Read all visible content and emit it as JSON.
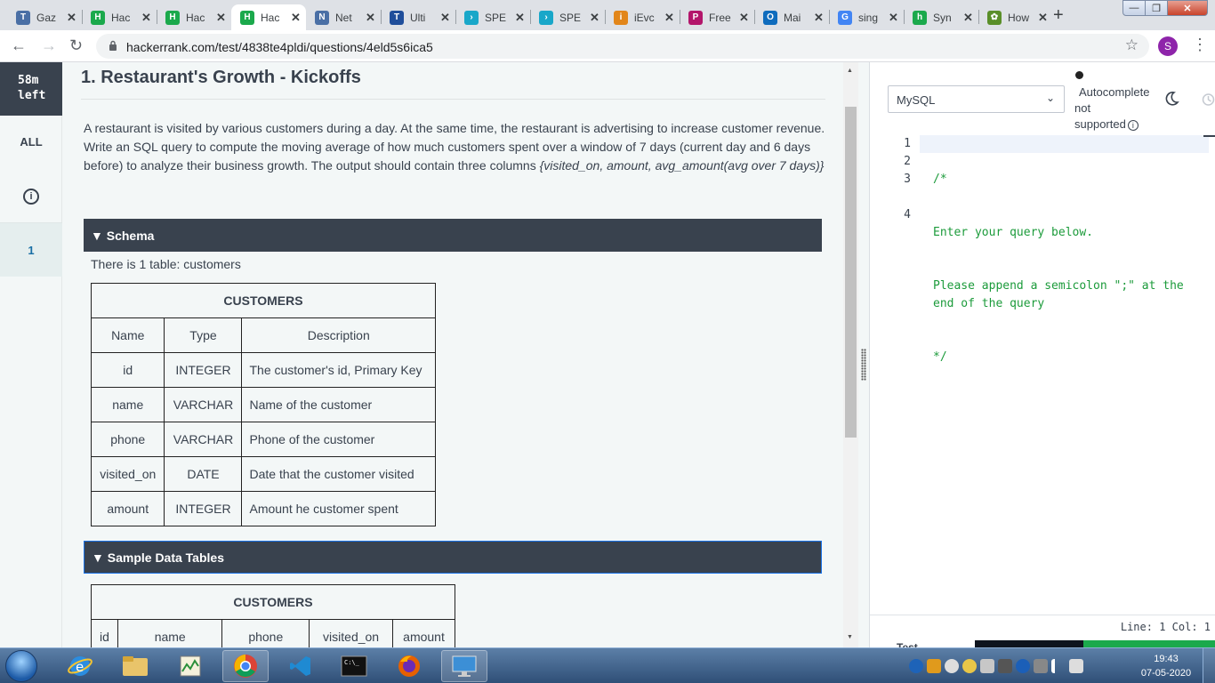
{
  "browser": {
    "tabs": [
      {
        "title": "Gaz",
        "color": "#4a6fa5",
        "glyph": "T"
      },
      {
        "title": "Hac",
        "color": "#1ba94c",
        "glyph": "H"
      },
      {
        "title": "Hac",
        "color": "#1ba94c",
        "glyph": "H"
      },
      {
        "title": "Hac",
        "color": "#1ba94c",
        "glyph": "H",
        "active": true
      },
      {
        "title": "Net",
        "color": "#4a6fa5",
        "glyph": "N"
      },
      {
        "title": "Ulti",
        "color": "#1f4e9b",
        "glyph": "T"
      },
      {
        "title": "SPE",
        "color": "#19a7c9",
        "glyph": "›"
      },
      {
        "title": "SPE",
        "color": "#19a7c9",
        "glyph": "›"
      },
      {
        "title": "iEvc",
        "color": "#e2861a",
        "glyph": "i"
      },
      {
        "title": "Free",
        "color": "#b3166b",
        "glyph": "P"
      },
      {
        "title": "Mai",
        "color": "#0f6cbd",
        "glyph": "O"
      },
      {
        "title": "sing",
        "color": "#4285f4",
        "glyph": "G"
      },
      {
        "title": "Syn",
        "color": "#1ba94c",
        "glyph": "h"
      },
      {
        "title": "How",
        "color": "#5a8f29",
        "glyph": "✿"
      }
    ],
    "new_tab": "+",
    "url": "hackerrank.com/test/4838te4pldi/questions/4eld5s6ica5",
    "profile_initial": "S"
  },
  "sidebar": {
    "timer_value": "58m",
    "timer_unit": "left",
    "all_label": "ALL",
    "info_glyph": "i",
    "question_number": "1"
  },
  "problem": {
    "title": "1. Restaurant's Growth - Kickoffs",
    "description_main": "A restaurant is visited by various customers during a day. At the same time, the restaurant is advertising to increase customer revenue. Write an SQL query to compute the moving average of how much customers spent over a window of 7 days (current day and 6 days before) to analyze their business growth. The output should contain three columns ",
    "description_columns": "{visited_on, amount, avg_amount(avg over 7 days)}",
    "schema_header": "Schema",
    "schema_note": "There is 1 table: customers",
    "schema_table": {
      "title": "CUSTOMERS",
      "headers": [
        "Name",
        "Type",
        "Description"
      ],
      "rows": [
        [
          "id",
          "INTEGER",
          "The customer's id, Primary Key"
        ],
        [
          "name",
          "VARCHAR",
          "Name of the customer"
        ],
        [
          "phone",
          "VARCHAR",
          "Phone of the customer"
        ],
        [
          "visited_on",
          "DATE",
          "Date that the customer visited"
        ],
        [
          "amount",
          "INTEGER",
          "Amount he customer spent"
        ]
      ]
    },
    "sample_header": "Sample Data Tables",
    "sample_table": {
      "title": "CUSTOMERS",
      "headers": [
        "id",
        "name",
        "phone",
        "visited_on",
        "amount"
      ]
    }
  },
  "editor": {
    "language": "MySQL",
    "autocomplete_lines": [
      "Autocomplete",
      "not",
      "supported"
    ],
    "code_lines": [
      {
        "num": "1",
        "text": "/*"
      },
      {
        "num": "2",
        "text": "Enter your query below."
      },
      {
        "num": "3",
        "text": "Please append a semicolon \";\" at the end of the query"
      },
      {
        "num": "4",
        "text": "*/"
      }
    ],
    "status": "Line: 1 Col: 1",
    "bottom_label": "Test"
  },
  "taskbar": {
    "time": "19:43",
    "date": "07-05-2020"
  }
}
